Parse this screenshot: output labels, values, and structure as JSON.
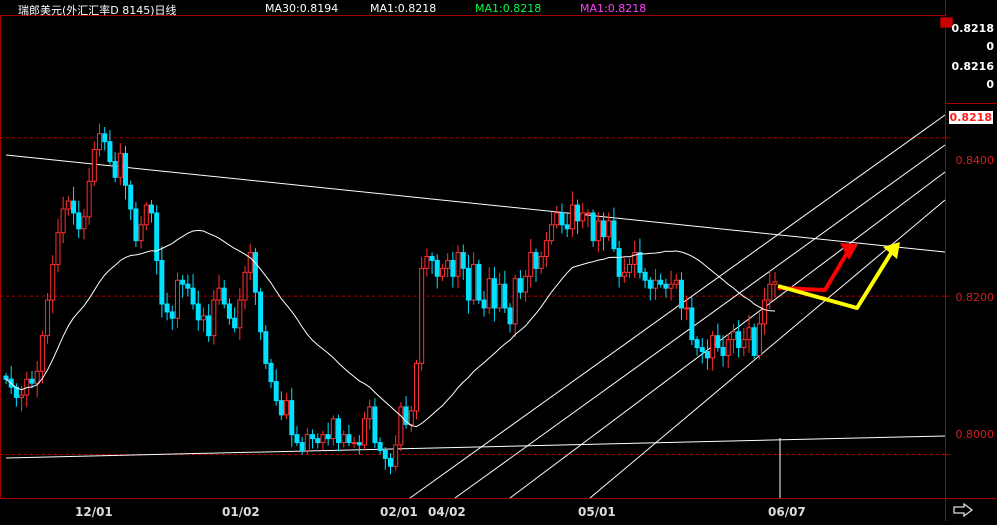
{
  "header": {
    "symbol": "瑞郎美元(外汇汇率D 8145)日线",
    "ma30": "MA30:0.8194",
    "ma1_white": "MA1:0.8218",
    "ma1_green": "MA1:0.8218",
    "ma1_magenta": "MA1:0.8218"
  },
  "right_axis": {
    "top_values": [
      "0.8218",
      "0",
      "0.8216",
      "0"
    ],
    "current_price": "0.8218",
    "ticks": [
      "0.8400",
      "0.8200",
      "0.8000"
    ]
  },
  "colors": {
    "up": "#ff3030",
    "down": "#00e0ff",
    "ma": "#ffffff",
    "grid": "#aa0000",
    "trend": "#ffffff",
    "arrow_red": "#ff0000",
    "arrow_yellow": "#ffff00"
  },
  "chart_data": {
    "type": "candlestick",
    "title": "瑞郎美元(外汇汇率D 8145)日线",
    "y_range": [
      0.7945,
      0.8555
    ],
    "x_tick_labels": [
      "12/01",
      "01/02",
      "02/01",
      "04/02",
      "05/01",
      "06/07"
    ],
    "ma30_last": 0.8194,
    "close_series": [
      0.8095,
      0.8085,
      0.8072,
      0.8075,
      0.8095,
      0.809,
      0.8105,
      0.815,
      0.8195,
      0.824,
      0.828,
      0.831,
      0.832,
      0.8305,
      0.8285,
      0.83,
      0.8345,
      0.8385,
      0.8405,
      0.8395,
      0.837,
      0.835,
      0.838,
      0.834,
      0.831,
      0.827,
      0.829,
      0.8315,
      0.8305,
      0.8245,
      0.819,
      0.818,
      0.8172,
      0.822,
      0.8215,
      0.821,
      0.819,
      0.817,
      0.8175,
      0.815,
      0.8195,
      0.821,
      0.819,
      0.8172,
      0.816,
      0.8195,
      0.823,
      0.8255,
      0.8205,
      0.8155,
      0.8115,
      0.8092,
      0.8068,
      0.805,
      0.8068,
      0.8025,
      0.8015,
      0.8005,
      0.8025,
      0.802,
      0.8015,
      0.8025,
      0.802,
      0.8045,
      0.8015,
      0.8025,
      0.8015,
      0.8015,
      0.8012,
      0.8045,
      0.806,
      0.8015,
      0.8005,
      0.7995,
      0.7985,
      0.8012,
      0.806,
      0.8038,
      0.8055,
      0.8115,
      0.8235,
      0.825,
      0.8245,
      0.8225,
      0.8235,
      0.8245,
      0.8225,
      0.8255,
      0.8235,
      0.8195,
      0.824,
      0.8195,
      0.8185,
      0.8222,
      0.8185,
      0.8215,
      0.8185,
      0.8165,
      0.8222,
      0.8205,
      0.8225,
      0.8255,
      0.8235,
      0.825,
      0.827,
      0.829,
      0.8305,
      0.829,
      0.8285,
      0.8315,
      0.8295,
      0.8305,
      0.8305,
      0.827,
      0.8295,
      0.8275,
      0.8295,
      0.826,
      0.8225,
      0.823,
      0.824,
      0.8255,
      0.823,
      0.822,
      0.821,
      0.822,
      0.8215,
      0.821,
      0.8215,
      0.822,
      0.8185,
      0.8185,
      0.8145,
      0.8135,
      0.813,
      0.8122,
      0.815,
      0.8135,
      0.8125,
      0.8145,
      0.8155,
      0.8135,
      0.8145,
      0.816,
      0.8125,
      0.8165,
      0.8195,
      0.8215,
      0.8218
    ]
  }
}
